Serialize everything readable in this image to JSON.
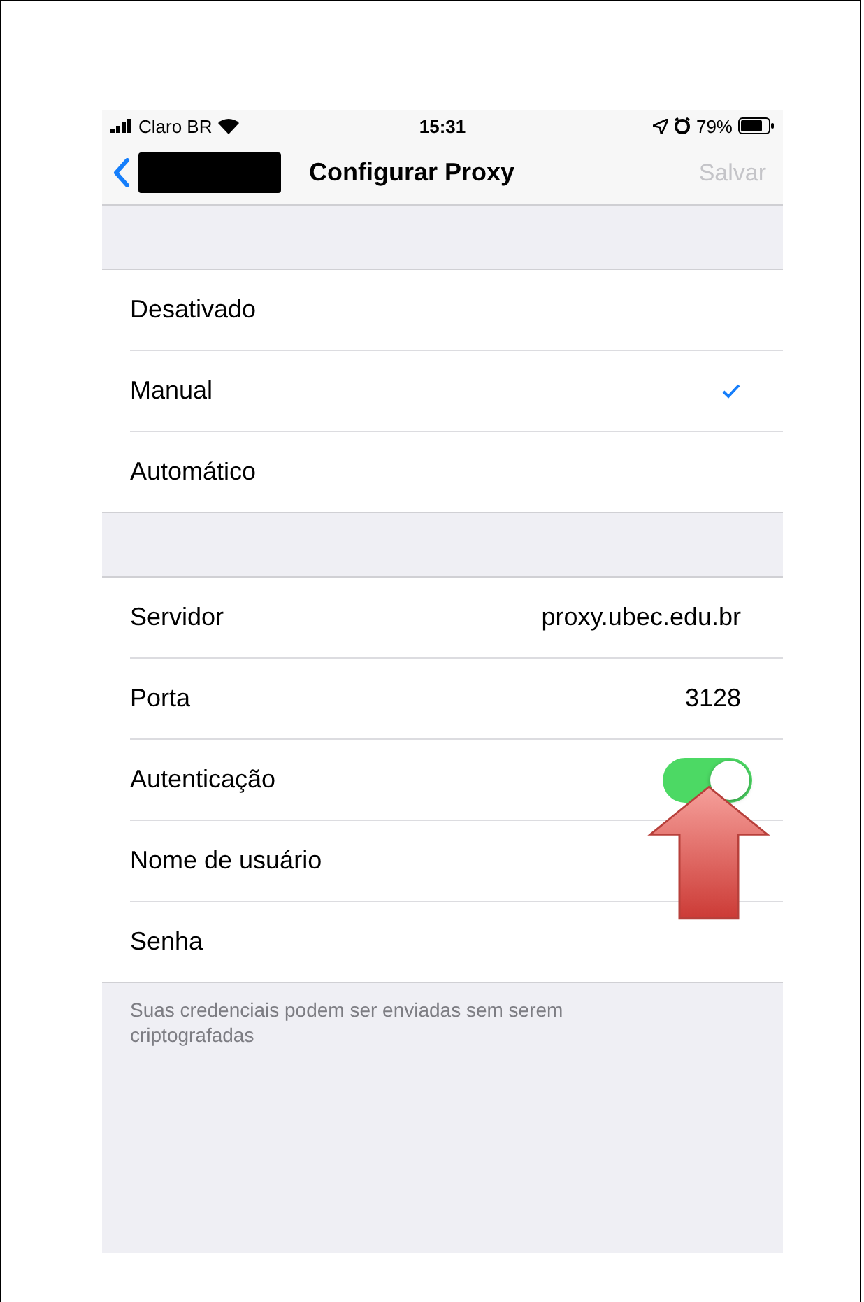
{
  "status_bar": {
    "carrier": "Claro BR",
    "time": "15:31",
    "battery": "79%"
  },
  "nav_bar": {
    "title": "Configurar Proxy",
    "action": "Salvar",
    "action_disabled": true
  },
  "proxy_modes": [
    {
      "label": "Desativado",
      "selected": false
    },
    {
      "label": "Manual",
      "selected": true
    },
    {
      "label": "Automático",
      "selected": false
    }
  ],
  "settings": [
    {
      "kind": "value",
      "label": "Servidor",
      "value": "proxy.ubec.edu.br"
    },
    {
      "kind": "value",
      "label": "Porta",
      "value": "3128"
    },
    {
      "kind": "toggle",
      "label": "Autenticação",
      "on": true
    },
    {
      "kind": "input",
      "label": "Nome de usuário"
    },
    {
      "kind": "input",
      "label": "Senha"
    }
  ],
  "footer": "Suas credenciais podem ser enviadas sem serem criptografadas"
}
